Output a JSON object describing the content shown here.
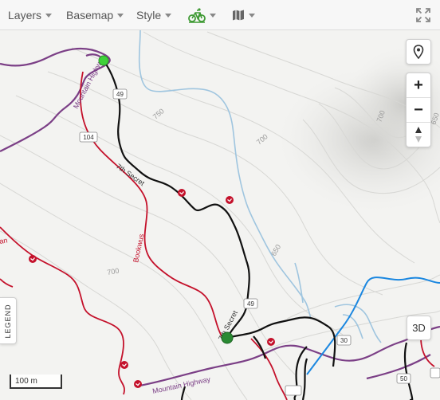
{
  "toolbar": {
    "layers_label": "Layers",
    "basemap_label": "Basemap",
    "style_label": "Style"
  },
  "controls": {
    "zoom_in": "+",
    "zoom_out": "−",
    "view_3d": "3D",
    "legend": "LEGEND",
    "scale": "100 m"
  },
  "map": {
    "contour_labels": [
      "750",
      "700",
      "700",
      "650",
      "650",
      "700"
    ],
    "route_labels": [
      "Mountain Highway",
      "7th Secret",
      "Bookwus",
      "7th Secret",
      "Mountain Highway",
      "an"
    ],
    "route_shields": [
      "49",
      "104",
      "49",
      "30",
      "50"
    ]
  },
  "colors": {
    "trail_black": "#111111",
    "trail_red": "#c4112b",
    "road_purple": "#7b3f86",
    "creek": "#9fc5df",
    "trail_blue": "#1b87e0",
    "start_marker": "#3fd13a",
    "end_marker": "#2a8a33"
  }
}
